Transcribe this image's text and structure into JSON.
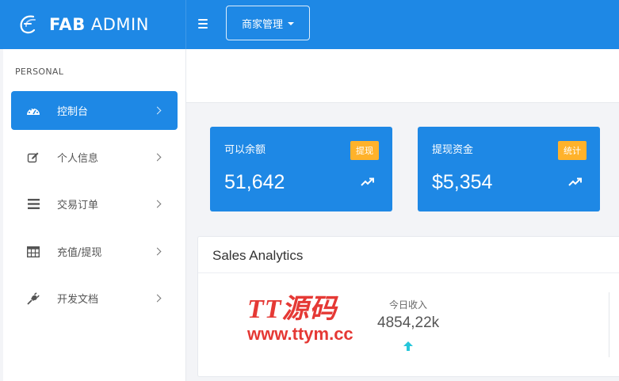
{
  "brand": {
    "bold": "FAB",
    "light": "ADMIN"
  },
  "topbar": {
    "menu_icon": "hamburger-icon",
    "dropdown_label": "商家管理"
  },
  "sidebar": {
    "section": "PERSONAL",
    "items": [
      {
        "label": "控制台",
        "icon": "dashboard-icon",
        "active": true
      },
      {
        "label": "个人信息",
        "icon": "edit-icon",
        "active": false
      },
      {
        "label": "交易订单",
        "icon": "list-icon",
        "active": false
      },
      {
        "label": "充值/提现",
        "icon": "table-icon",
        "active": false
      },
      {
        "label": "开发文档",
        "icon": "plug-icon",
        "active": false
      }
    ]
  },
  "stats": [
    {
      "title": "可以余额",
      "badge": "提现",
      "value": "51,642",
      "icon": "trend-up-icon"
    },
    {
      "title": "提现资金",
      "badge": "统计",
      "value": "$5,354",
      "icon": "trend-up-icon"
    }
  ],
  "analytics": {
    "title": "Sales Analytics",
    "watermark_top": "TT源码",
    "watermark_bottom": "www.ttym.cc",
    "metric_label": "今日收入",
    "metric_value": "4854,22k",
    "metric_icon": "arrow-up-icon"
  },
  "colors": {
    "primary": "#1e88e5",
    "badge": "#ffb22b",
    "watermark": "#e53935",
    "arrow": "#26c6da"
  }
}
